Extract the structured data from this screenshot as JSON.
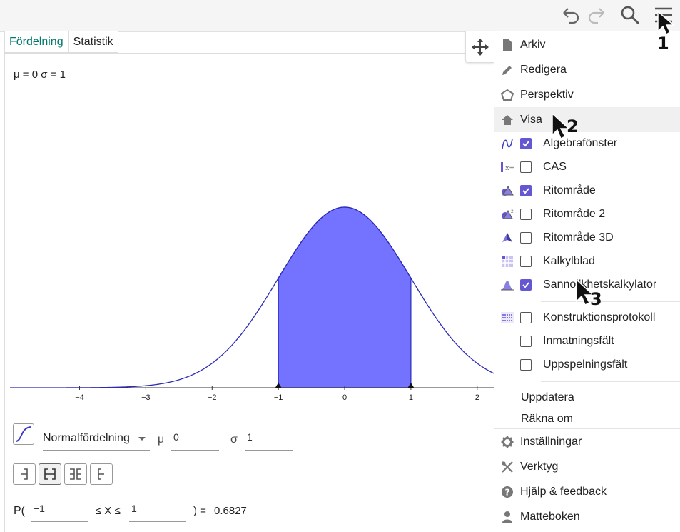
{
  "toolbar": {
    "undo_icon": "undo-icon",
    "redo_icon": "redo-icon",
    "search_icon": "search-icon",
    "menu_icon": "hamburger-menu-icon"
  },
  "tabs": [
    {
      "label": "Fördelning",
      "active": true
    },
    {
      "label": "Statistik",
      "active": false
    }
  ],
  "parameters_text": "μ = 0 σ = 1",
  "chart_data": {
    "type": "area",
    "distribution": "normal",
    "mu": 0,
    "sigma": 1,
    "x_ticks": [
      "−4",
      "−3",
      "−2",
      "−1",
      "0",
      "1",
      "2"
    ],
    "xlim": [
      -5.05,
      2.25
    ],
    "shaded_interval": [
      -1,
      1
    ],
    "fill_color": "#7373ff",
    "line_color": "#2b2bb8"
  },
  "controls": {
    "distribution_select": "Normalfördelning",
    "mu_label": "μ",
    "mu_value": "0",
    "sigma_label": "σ",
    "sigma_value": "1",
    "interval_types": [
      "left-sided-icon",
      "interval-icon",
      "two-tailed-icon",
      "right-sided-icon"
    ],
    "probability_prefix": "P(",
    "lower_value": "−1",
    "middle_text": "≤ X ≤",
    "upper_value": "1",
    "result_prefix": ") =",
    "result_value": "0.6827"
  },
  "menu": {
    "items_top": [
      {
        "label": "Arkiv",
        "icon": "file-icon"
      },
      {
        "label": "Redigera",
        "icon": "pencil-icon"
      },
      {
        "label": "Perspektiv",
        "icon": "pentagon-icon"
      },
      {
        "label": "Visa",
        "icon": "home-icon",
        "selected": true
      }
    ],
    "views": [
      {
        "label": "Algebrafönster",
        "icon": "algebra-view-icon",
        "checked": true
      },
      {
        "label": "CAS",
        "icon": "cas-icon",
        "checked": false
      },
      {
        "label": "Ritområde",
        "icon": "graphics-view-icon",
        "checked": true
      },
      {
        "label": "Ritområde 2",
        "icon": "graphics-view-2-icon",
        "checked": false
      },
      {
        "label": "Ritområde 3D",
        "icon": "graphics-3d-icon",
        "checked": false
      },
      {
        "label": "Kalkylblad",
        "icon": "spreadsheet-icon",
        "checked": false
      },
      {
        "label": "Sannolikhetskalkylator",
        "icon": "probability-calculator-icon",
        "checked": true
      },
      {
        "label": "Konstruktionsprotokoll",
        "icon": "construction-protocol-icon",
        "checked": false
      },
      {
        "label": "Inmatningsfält",
        "icon": "",
        "checked": false
      },
      {
        "label": "Uppspelningsfält",
        "icon": "",
        "checked": false
      }
    ],
    "actions": [
      "Uppdatera",
      "Räkna om"
    ],
    "items_bottom": [
      {
        "label": "Inställningar",
        "icon": "gear-icon"
      },
      {
        "label": "Verktyg",
        "icon": "tools-icon"
      },
      {
        "label": "Hjälp & feedback",
        "icon": "help-icon"
      },
      {
        "label": "Matteboken",
        "icon": "person-icon"
      }
    ]
  },
  "annotations": [
    "1",
    "2",
    "3"
  ]
}
